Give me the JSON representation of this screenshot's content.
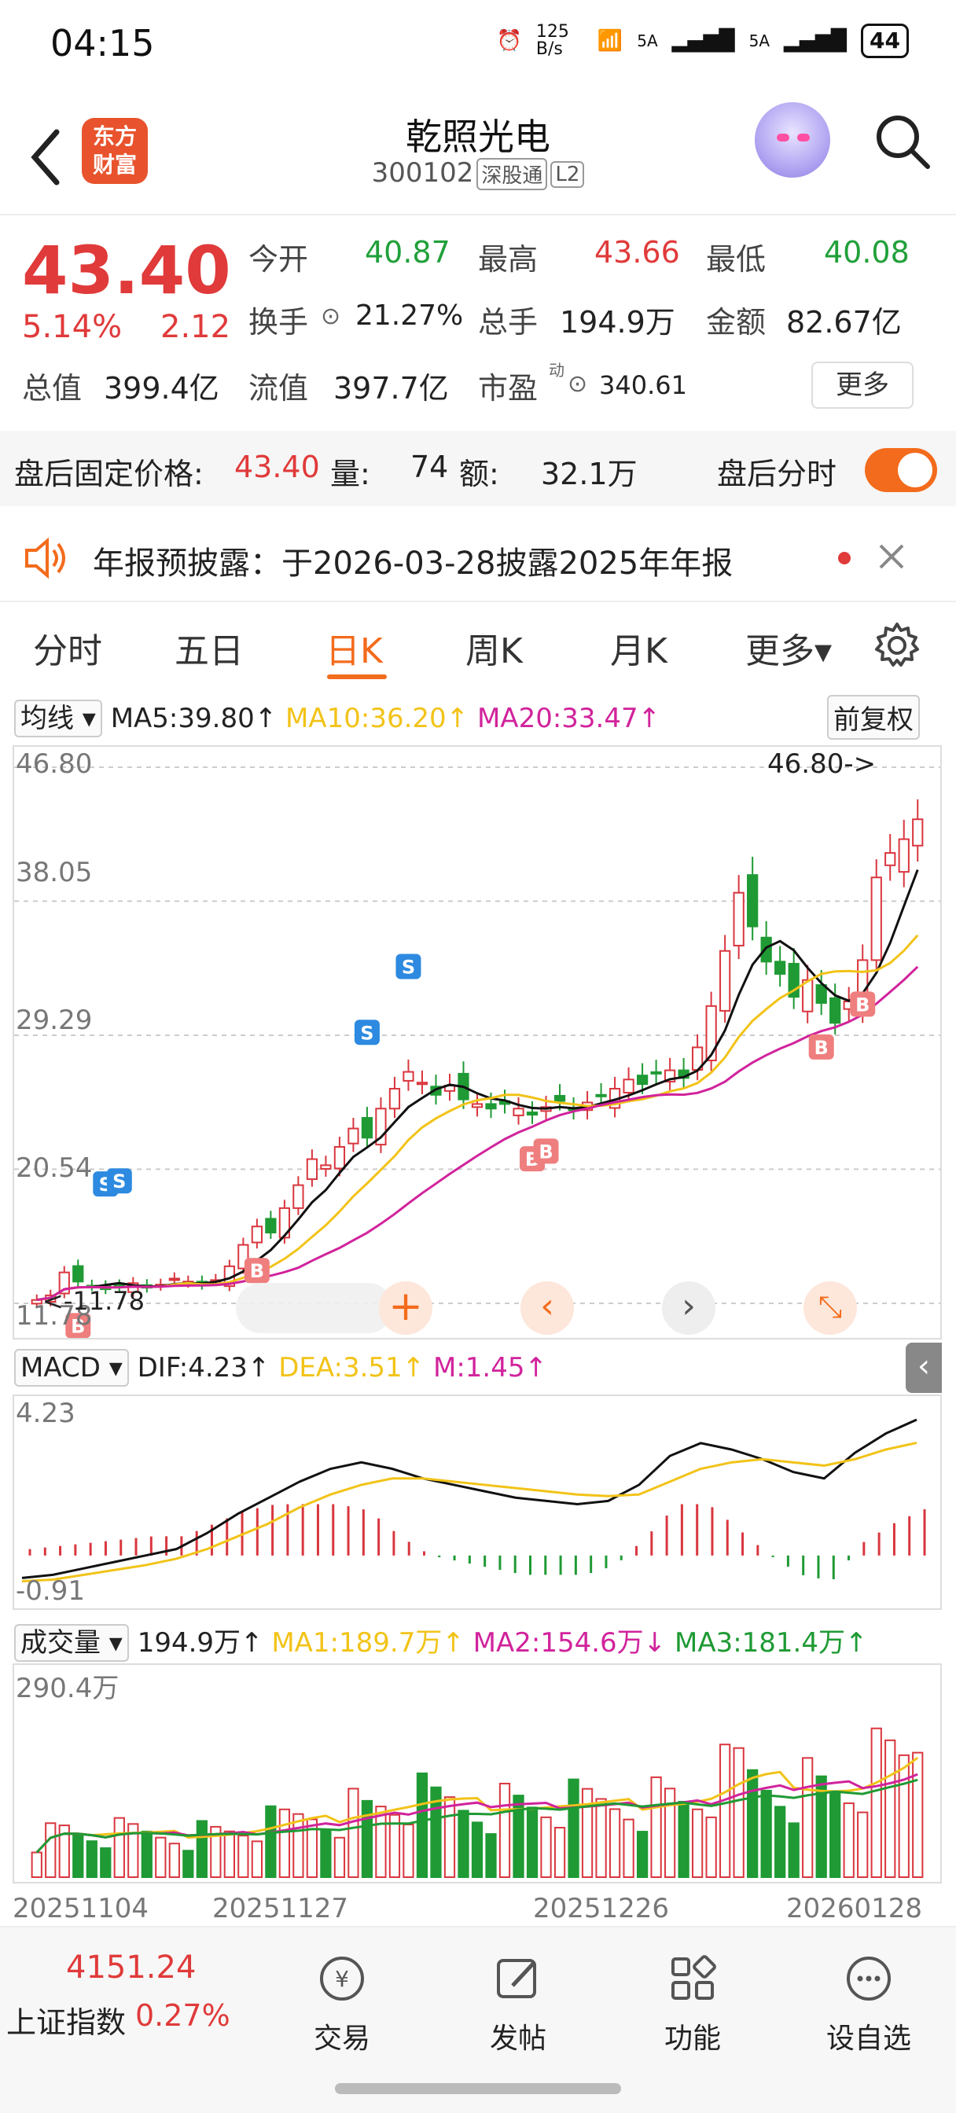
{
  "status": {
    "time": "04:15",
    "net_speed": "125 B/s",
    "signal1": "5A",
    "signal2": "5A",
    "battery": "44"
  },
  "header": {
    "title": "乾照光电",
    "code": "300102",
    "tag1": "深股通",
    "tag2": "L2",
    "logo_text1": "东方",
    "logo_text2": "财富"
  },
  "quote": {
    "price": "43.40",
    "pct": "5.14%",
    "change": "2.12",
    "open_label": "今开",
    "open": "40.87",
    "high_label": "最高",
    "high": "43.66",
    "low_label": "最低",
    "low": "40.08",
    "turnover_label": "换手",
    "turnover": "21.27%",
    "vol_label": "总手",
    "vol": "194.9万",
    "amount_label": "金额",
    "amount": "82.67亿",
    "mcap_label": "总值",
    "mcap": "399.4亿",
    "float_label": "流值",
    "float": "397.7亿",
    "pe_label": "市盈",
    "pe_sup": "动",
    "pe": "340.61",
    "more": "更多"
  },
  "after": {
    "label": "盘后固定价格:",
    "price": "43.40",
    "vol_label": "量:",
    "vol": "74",
    "amt_label": "额:",
    "amt": "32.1万",
    "switch_label": "盘后分时"
  },
  "notice": {
    "text": "年报预披露：于2026-03-28披露2025年年报"
  },
  "tabs": [
    "分时",
    "五日",
    "日K",
    "周K",
    "月K",
    "更多▾"
  ],
  "kline": {
    "ma_selector": "均线",
    "ma5": "MA5:39.80↑",
    "ma10": "MA10:36.20↑",
    "ma20": "MA20:33.47↑",
    "adjust": "前复权",
    "y_labels": [
      "46.80",
      "38.05",
      "29.29",
      "20.54",
      "11.78"
    ],
    "max_marker": "46.80->",
    "min_marker": "<-11.78",
    "color_ma5": "#111111",
    "color_ma10": "#f2c318",
    "color_ma20": "#d1239c",
    "color_up": "#d9363e",
    "color_down": "#1f9a34"
  },
  "macd": {
    "selector": "MACD",
    "dif": "DIF:4.23↑",
    "dea": "DEA:3.51↑",
    "m": "M:1.45↑",
    "y_top": "4.23",
    "y_bottom": "-0.91"
  },
  "volume": {
    "selector": "成交量",
    "vol": "194.9万↑",
    "ma1": "MA1:189.7万↑",
    "ma2": "MA2:154.6万↓",
    "ma3": "MA3:181.4万↑",
    "y_top": "290.4万",
    "dates": [
      "20251104",
      "20251127",
      "20251226",
      "20260128"
    ]
  },
  "bottom": {
    "index_value": "4151.24",
    "index_name": "上证指数",
    "index_pct": "0.27%",
    "nav": [
      "交易",
      "发帖",
      "功能",
      "设自选"
    ]
  },
  "chart_data": [
    {
      "type": "candlestick",
      "title": "",
      "ylim": [
        11.78,
        46.8
      ],
      "y_ticks": [
        46.8,
        38.05,
        29.29,
        20.54,
        11.78
      ],
      "x_dates": [
        "20251104",
        "20251127",
        "20251226",
        "20260128"
      ],
      "close": [
        12.0,
        12.3,
        13.8,
        13.2,
        12.9,
        12.7,
        12.9,
        13.1,
        12.8,
        13.0,
        13.4,
        13.2,
        13.0,
        13.3,
        14.2,
        15.6,
        16.8,
        16.4,
        18.0,
        19.5,
        21.2,
        20.8,
        22.0,
        23.2,
        22.6,
        24.5,
        25.8,
        26.9,
        26.2,
        25.4,
        26.0,
        25.1,
        24.8,
        24.5,
        24.8,
        24.5,
        24.1,
        24.6,
        25.0,
        24.4,
        24.9,
        25.3,
        25.8,
        26.4,
        26.1,
        26.8,
        27.0,
        26.5,
        28.5,
        31.2,
        34.8,
        38.6,
        36.4,
        34.1,
        33.3,
        31.8,
        32.9,
        31.4,
        30.1,
        31.5,
        34.2,
        39.6,
        41.2,
        42.1,
        43.4
      ],
      "ma5_last": 39.8,
      "ma10_last": 36.2,
      "ma20_last": 33.47
    },
    {
      "type": "line",
      "title": "",
      "ylim": [
        -0.91,
        4.23
      ],
      "dif": [
        -0.7,
        -0.6,
        -0.4,
        -0.2,
        0.0,
        0.2,
        0.7,
        1.3,
        1.8,
        2.3,
        2.7,
        2.9,
        2.7,
        2.4,
        2.2,
        2.0,
        1.8,
        1.7,
        1.6,
        1.7,
        2.2,
        3.1,
        3.5,
        3.3,
        3.0,
        2.6,
        2.4,
        3.2,
        3.8,
        4.23
      ],
      "dea": [
        -0.8,
        -0.75,
        -0.6,
        -0.45,
        -0.3,
        -0.1,
        0.2,
        0.6,
        1.0,
        1.5,
        1.9,
        2.2,
        2.4,
        2.4,
        2.3,
        2.2,
        2.1,
        2.0,
        1.9,
        1.85,
        1.9,
        2.3,
        2.7,
        2.9,
        3.0,
        2.9,
        2.8,
        3.0,
        3.3,
        3.51
      ],
      "m_last": 1.45
    },
    {
      "type": "bar",
      "title": "",
      "ylim": [
        0,
        290.4
      ],
      "vol_last": 194.9,
      "ma1_last": 189.7,
      "ma2_last": 154.6,
      "ma3_last": 181.4
    }
  ]
}
